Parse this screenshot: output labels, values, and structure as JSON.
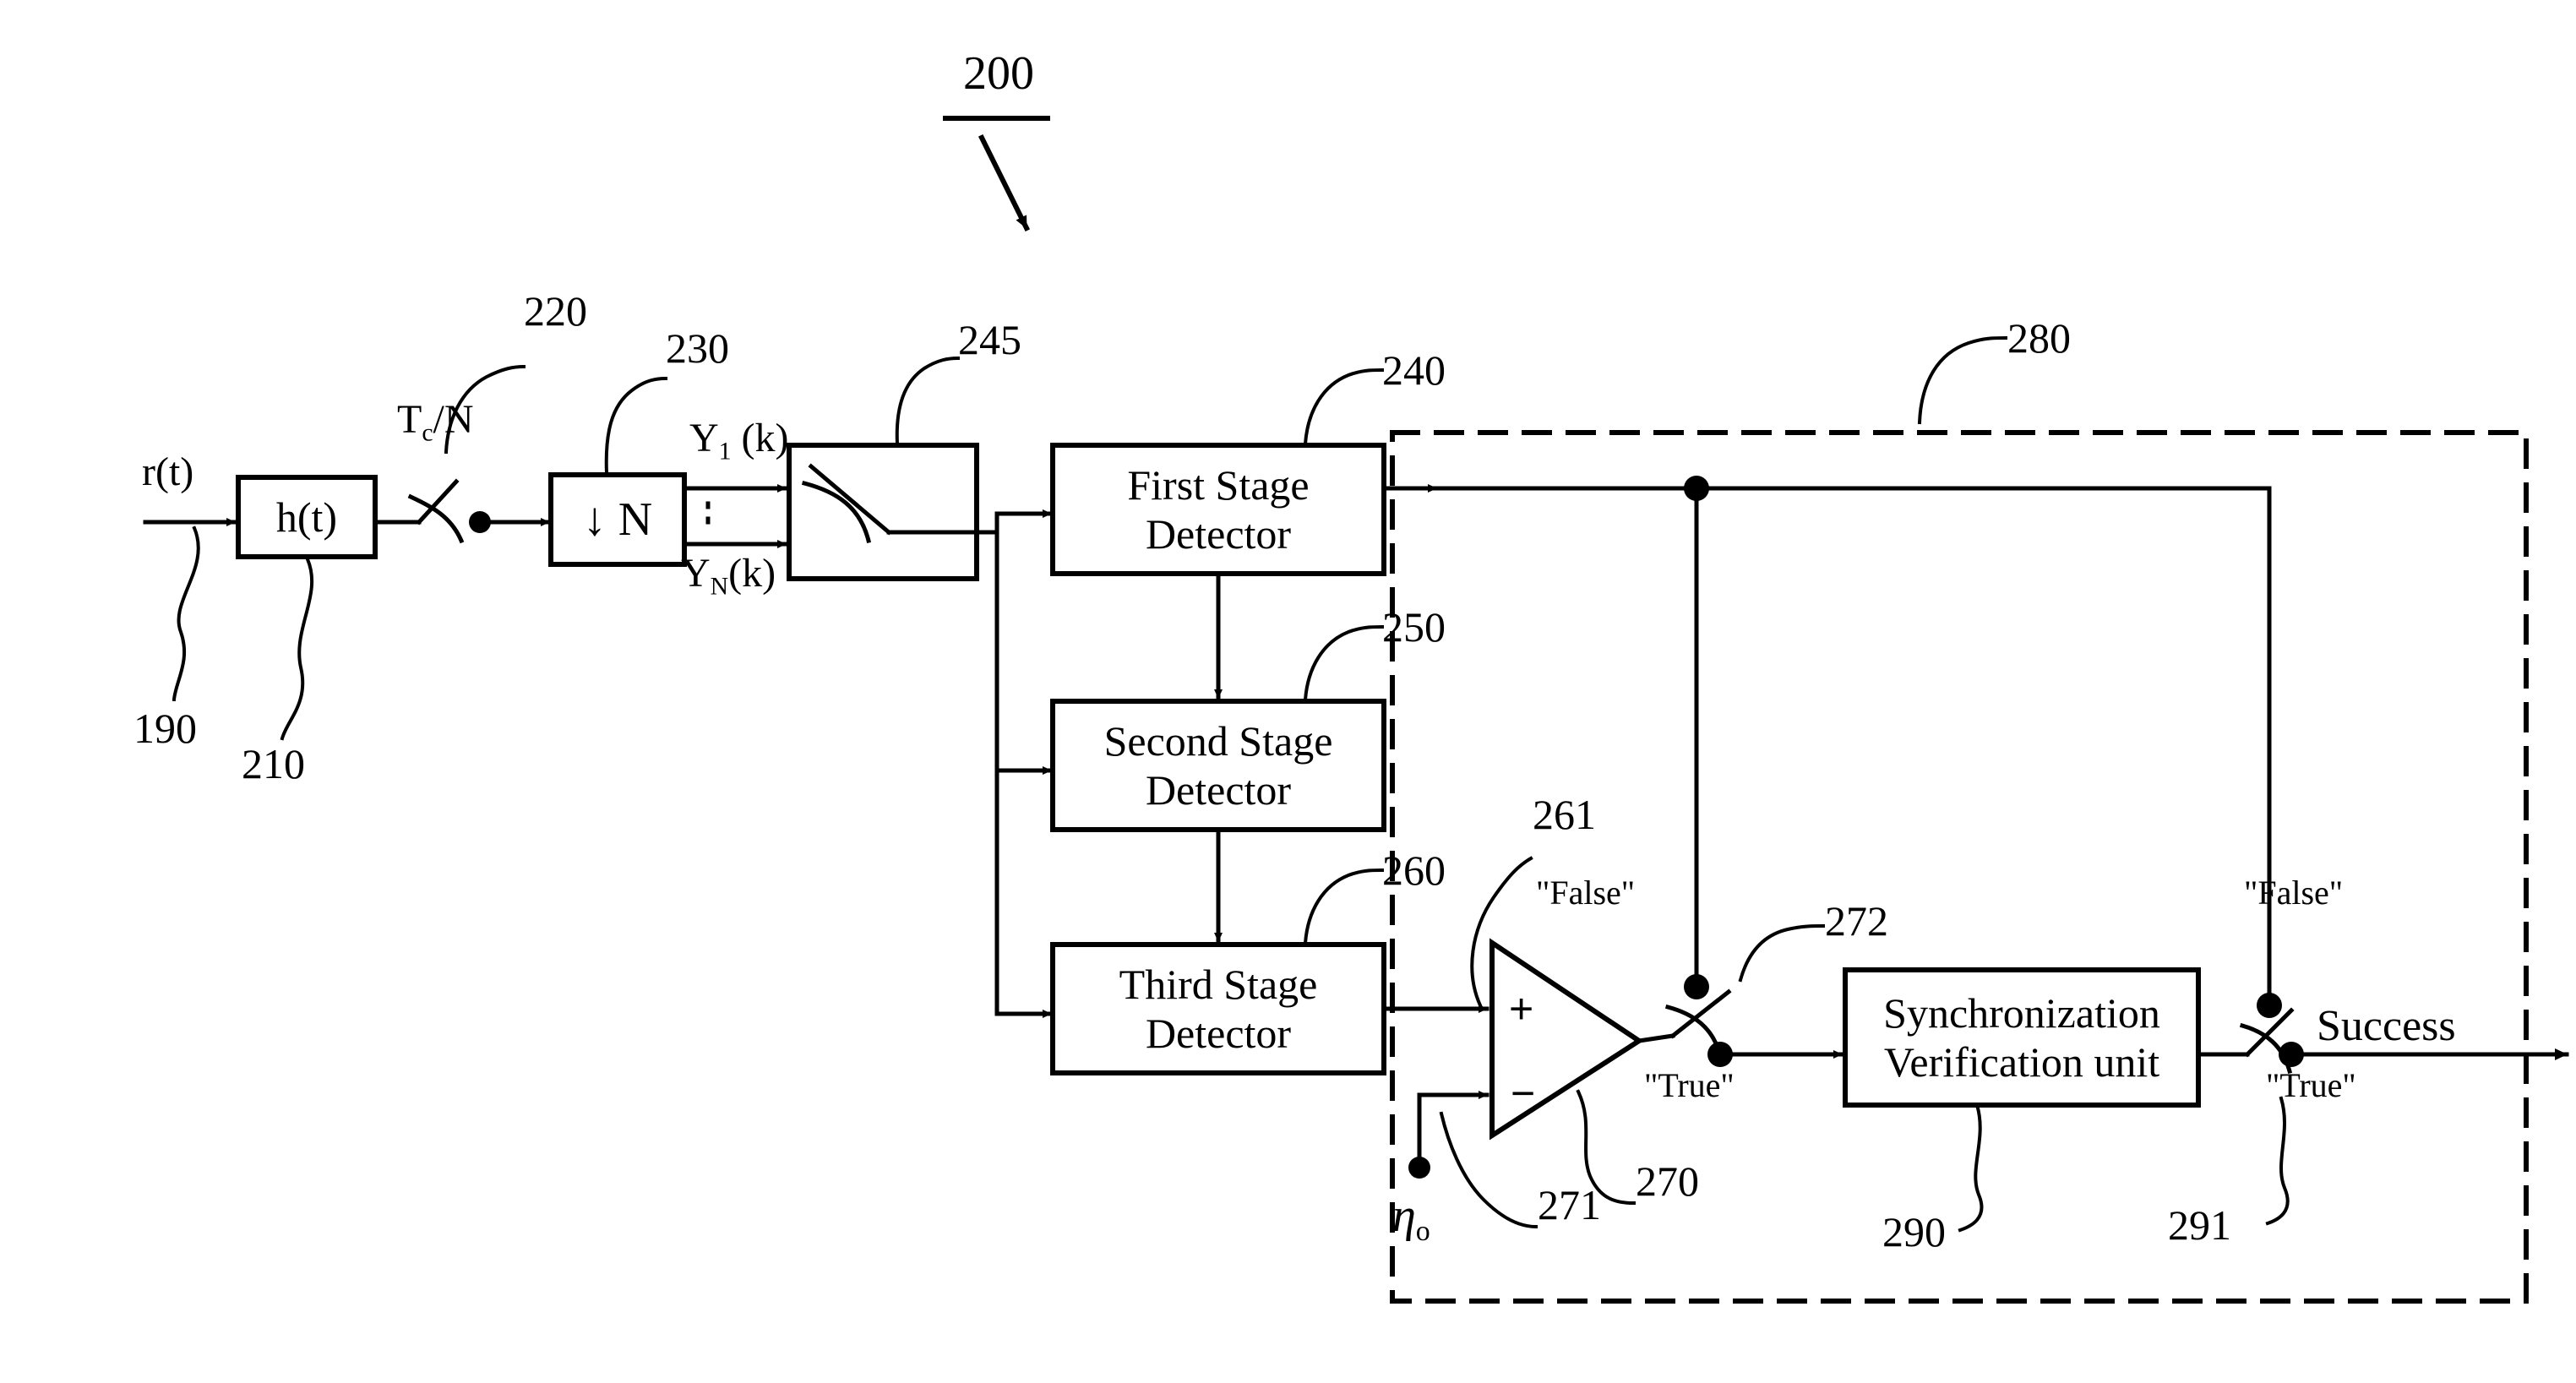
{
  "figure": {
    "number": "200",
    "title_visible": false
  },
  "blocks": {
    "filter": {
      "label": "h(t)",
      "ref": "210"
    },
    "downsampler": {
      "label": "↓ N",
      "ref": "230"
    },
    "selector": {
      "ref": "245"
    },
    "first_stage": {
      "line1": "First Stage",
      "line2": "Detector",
      "ref": "240"
    },
    "second_stage": {
      "line1": "Second Stage",
      "line2": "Detector",
      "ref": "250"
    },
    "third_stage": {
      "line1": "Third Stage",
      "line2": "Detector",
      "ref": "260"
    },
    "sync_verify": {
      "line1": "Synchronization",
      "line2": "Verification unit",
      "ref": "290"
    }
  },
  "signals": {
    "input": {
      "label": "r(t)",
      "ref": "190"
    },
    "sample_rate": {
      "label_main": "T",
      "label_sub": "c",
      "label_tail": "/N",
      "ref": "220"
    },
    "branch_first": {
      "main": "Y",
      "sub": "1",
      "tail": "(k)"
    },
    "branch_last": {
      "main": "Y",
      "sub": "N",
      "tail": "(k)"
    },
    "threshold": {
      "main": "η",
      "sub": "o"
    },
    "output": {
      "label": "Success"
    }
  },
  "comparator": {
    "ref_triangle": "270",
    "ref_plus_input": "261",
    "ref_minus_input": "271",
    "plus_sign": "+",
    "minus_sign": "−"
  },
  "switches": {
    "sampler": {
      "ref": "220"
    },
    "decision": {
      "ref": "272",
      "false_label": "\"False\"",
      "true_label": "\"True\""
    },
    "verification": {
      "ref": "291",
      "false_label": "\"False\"",
      "true_label": "\"True\""
    }
  },
  "boundary": {
    "ref": "280",
    "style": "dashed"
  },
  "colors": {
    "ink": "#000000",
    "paper": "#ffffff"
  }
}
